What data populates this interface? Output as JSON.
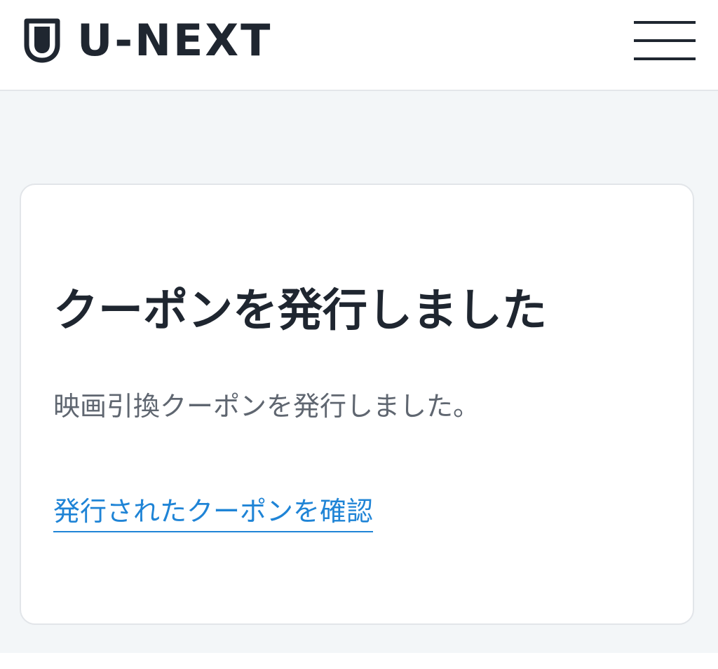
{
  "header": {
    "logo_text": "U-NEXT",
    "logo_icon": "shield-icon",
    "menu_icon": "hamburger-menu-icon"
  },
  "card": {
    "title": "クーポンを発行しました",
    "message": "映画引換クーポンを発行しました。",
    "link_label": "発行されたクーポンを確認"
  },
  "colors": {
    "text_dark": "#1f2630",
    "text_muted": "#5f6670",
    "link": "#1f84d6",
    "page_background": "#f3f6f8",
    "card_background": "#ffffff"
  }
}
